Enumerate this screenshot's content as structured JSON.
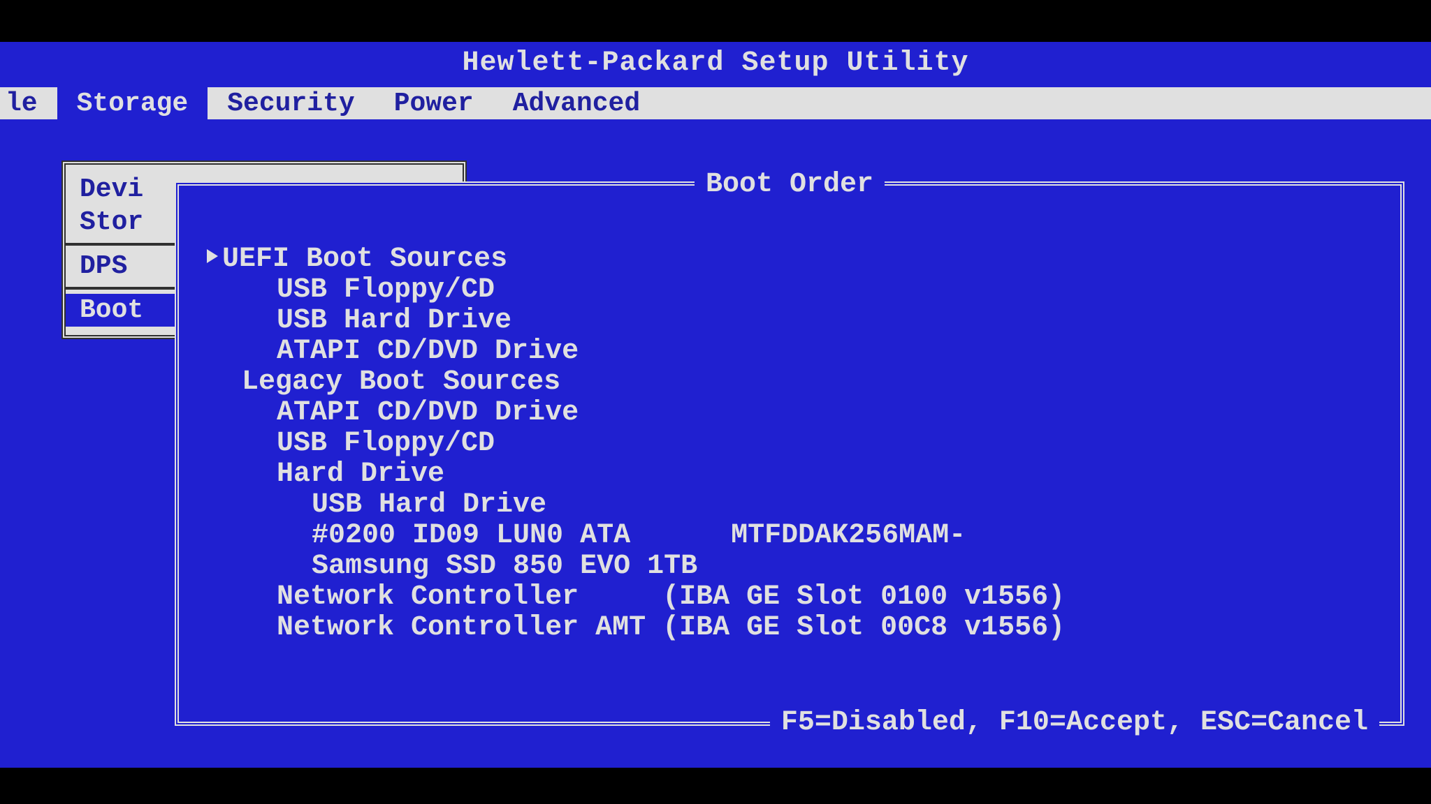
{
  "title": "Hewlett-Packard Setup Utility",
  "menubar": {
    "tabs": [
      "le",
      "Storage",
      "Security",
      "Power",
      "Advanced"
    ],
    "active": "Storage"
  },
  "storage_menu": {
    "items_top": [
      "Devi",
      "Stor"
    ],
    "item_mid": "DPS",
    "item_sel": "Boot"
  },
  "boot_panel": {
    "title": "Boot Order",
    "footer": "F5=Disabled, F10=Accept, ESC=Cancel",
    "uefi_header": "UEFI Boot Sources",
    "uefi_items": [
      "USB Floppy/CD",
      "USB Hard Drive",
      "ATAPI CD/DVD Drive"
    ],
    "legacy_header": "Legacy Boot Sources",
    "legacy_items": [
      "ATAPI CD/DVD Drive",
      "USB Floppy/CD"
    ],
    "hard_drive_header": "Hard Drive",
    "hard_drive_items": [
      "USB Hard Drive",
      "#0200 ID09 LUN0 ATA      MTFDDAK256MAM-",
      "Samsung SSD 850 EVO 1TB"
    ],
    "network_items": [
      "Network Controller     (IBA GE Slot 0100 v1556)",
      "Network Controller AMT (IBA GE Slot 00C8 v1556)"
    ]
  }
}
